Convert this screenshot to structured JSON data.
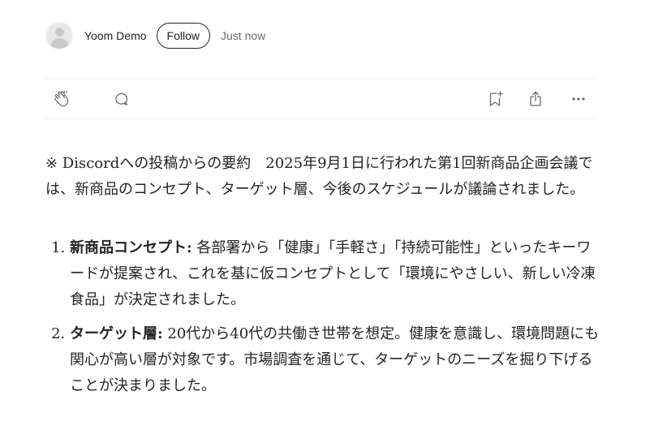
{
  "author": {
    "name": "Yoom Demo",
    "follow_label": "Follow",
    "timestamp": "Just now"
  },
  "actions": {
    "clap_icon": "clap-icon",
    "comment_icon": "comment-icon",
    "save_icon": "bookmark-add-icon",
    "share_icon": "share-icon",
    "more_icon": "more-icon"
  },
  "article": {
    "intro": "※ Discordへの投稿からの要約　2025年9月1日に行われた第1回新商品企画会議では、新商品のコンセプト、ターゲット層、今後のスケジュールが議論されました。",
    "items": [
      {
        "title": "新商品コンセプト:",
        "text": " 各部署から「健康」「手軽さ」「持続可能性」といったキーワードが提案され、これを基に仮コンセプトとして「環境にやさしい、新しい冷凍食品」が決定されました。"
      },
      {
        "title": "ターゲット層:",
        "text": " 20代から40代の共働き世帯を想定。健康を意識し、環境問題にも関心が高い層が対象です。市場調査を通じて、ターゲットのニーズを掘り下げることが決まりました。"
      }
    ]
  }
}
